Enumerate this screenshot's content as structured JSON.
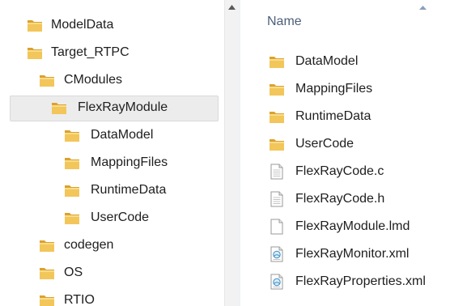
{
  "navigation": {
    "items": [
      {
        "label": "ModelData",
        "icon": "folder-icon"
      },
      {
        "label": "Target_RTPC",
        "icon": "folder-icon"
      },
      {
        "label": "CModules",
        "icon": "folder-icon"
      },
      {
        "label": "FlexRayModule",
        "icon": "folder-icon",
        "selected": true
      },
      {
        "label": "DataModel",
        "icon": "folder-icon"
      },
      {
        "label": "MappingFiles",
        "icon": "folder-icon"
      },
      {
        "label": "RuntimeData",
        "icon": "folder-icon"
      },
      {
        "label": "UserCode",
        "icon": "folder-icon"
      },
      {
        "label": "codegen",
        "icon": "folder-icon"
      },
      {
        "label": "OS",
        "icon": "folder-icon"
      },
      {
        "label": "RTIO",
        "icon": "folder-icon"
      }
    ]
  },
  "content": {
    "column_header": "Name",
    "sort": "ascending",
    "files": [
      {
        "name": "DataModel",
        "icon": "folder-icon"
      },
      {
        "name": "MappingFiles",
        "icon": "folder-icon"
      },
      {
        "name": "RuntimeData",
        "icon": "folder-icon"
      },
      {
        "name": "UserCode",
        "icon": "folder-icon"
      },
      {
        "name": "FlexRayCode.c",
        "icon": "text-file-icon"
      },
      {
        "name": "FlexRayCode.h",
        "icon": "text-file-icon"
      },
      {
        "name": "FlexRayModule.lmd",
        "icon": "blank-file-icon"
      },
      {
        "name": "FlexRayMonitor.xml",
        "icon": "xml-file-icon"
      },
      {
        "name": "FlexRayProperties.xml",
        "icon": "xml-file-icon"
      }
    ]
  },
  "colors": {
    "folder": "#e8b949",
    "header_text": "#4c607a",
    "selection_bg": "#ececec"
  }
}
